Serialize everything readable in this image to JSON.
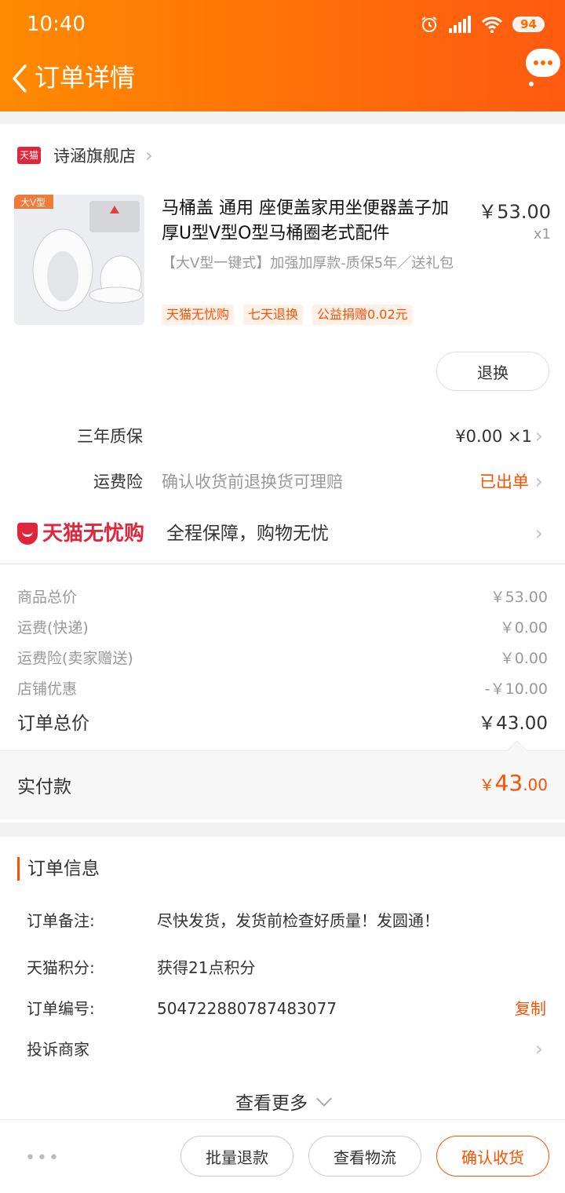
{
  "status": {
    "time": "10:40",
    "battery": "94"
  },
  "header": {
    "title": "订单详情"
  },
  "shop": {
    "logo_text": "天猫",
    "name": "诗涵旗舰店"
  },
  "product": {
    "image_text": "大V型",
    "title": "马桶盖 通用 座便盖家用坐便器盖子加厚U型V型O型马桶圈老式配件",
    "price": "￥53.00",
    "qty": "x1",
    "sku": "【大V型一键式】加强加厚款-质保5年／送礼包",
    "tags": [
      "天猫无忧购",
      "七天退换",
      "公益捐赠0.02元"
    ],
    "refund_label": "退换"
  },
  "services": {
    "warranty": {
      "label": "三年质保",
      "value": "¥0.00 ×1"
    },
    "freight_insurance": {
      "label": "运费险",
      "desc": "确认收货前退换货可理赔",
      "status": "已出单"
    }
  },
  "assurance": {
    "name": "天猫无忧购",
    "desc": "全程保障，购物无忧"
  },
  "fees": [
    {
      "label": "商品总价",
      "value": "￥53.00"
    },
    {
      "label": "运费(快递)",
      "value": "￥0.00"
    },
    {
      "label": "运费险(卖家赠送)",
      "value": "￥0.00"
    },
    {
      "label": "店铺优惠",
      "value": "-￥10.00"
    }
  ],
  "order_total": {
    "label": "订单总价",
    "value": "￥43.00"
  },
  "paid": {
    "label": "实付款",
    "currency": "￥",
    "integer": "43",
    "decimal": ".00"
  },
  "order_info": {
    "title": "订单信息",
    "remark": {
      "label": "订单备注:",
      "value": "尽快发货，发货前检查好质量！发圆通！"
    },
    "points": {
      "label": "天猫积分:",
      "value": "获得21点积分"
    },
    "order_no": {
      "label": "订单编号:",
      "value": "504722880787483077",
      "copy_label": "复制"
    },
    "complaint": {
      "label": "投诉商家"
    },
    "view_more": "查看更多"
  },
  "bottom_bar": {
    "more": "•••",
    "batch_refund": "批量退款",
    "logistics": "查看物流",
    "confirm": "确认收货"
  },
  "colors": {
    "accent": "#ff5000",
    "header_start": "#ff8a00",
    "header_end": "#ff5a10",
    "tmall_red": "#e0263c"
  }
}
